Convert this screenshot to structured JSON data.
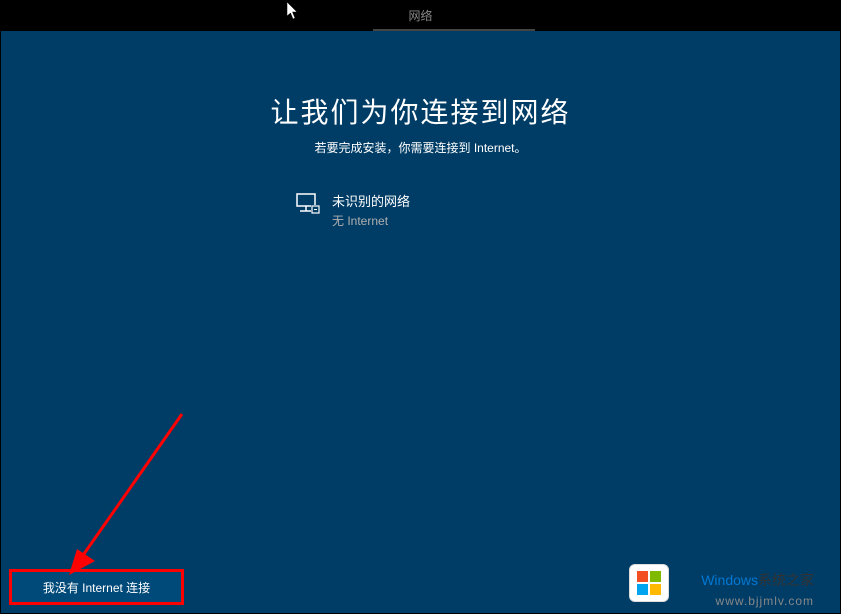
{
  "topbar": {
    "tab_label": "网络"
  },
  "main": {
    "heading": "让我们为你连接到网络",
    "subheading": "若要完成安装，你需要连接到 Internet。",
    "network": {
      "name": "未识别的网络",
      "status": "无 Internet"
    },
    "no_internet_button": "我没有 Internet 连接"
  },
  "watermark": {
    "brand_primary": "Windows",
    "brand_secondary": "系统之家",
    "url": "www.bjjmlv.com"
  },
  "colors": {
    "main_bg": "#003d66",
    "topbar_bg": "#000000",
    "annotation_red": "#ff0000"
  }
}
